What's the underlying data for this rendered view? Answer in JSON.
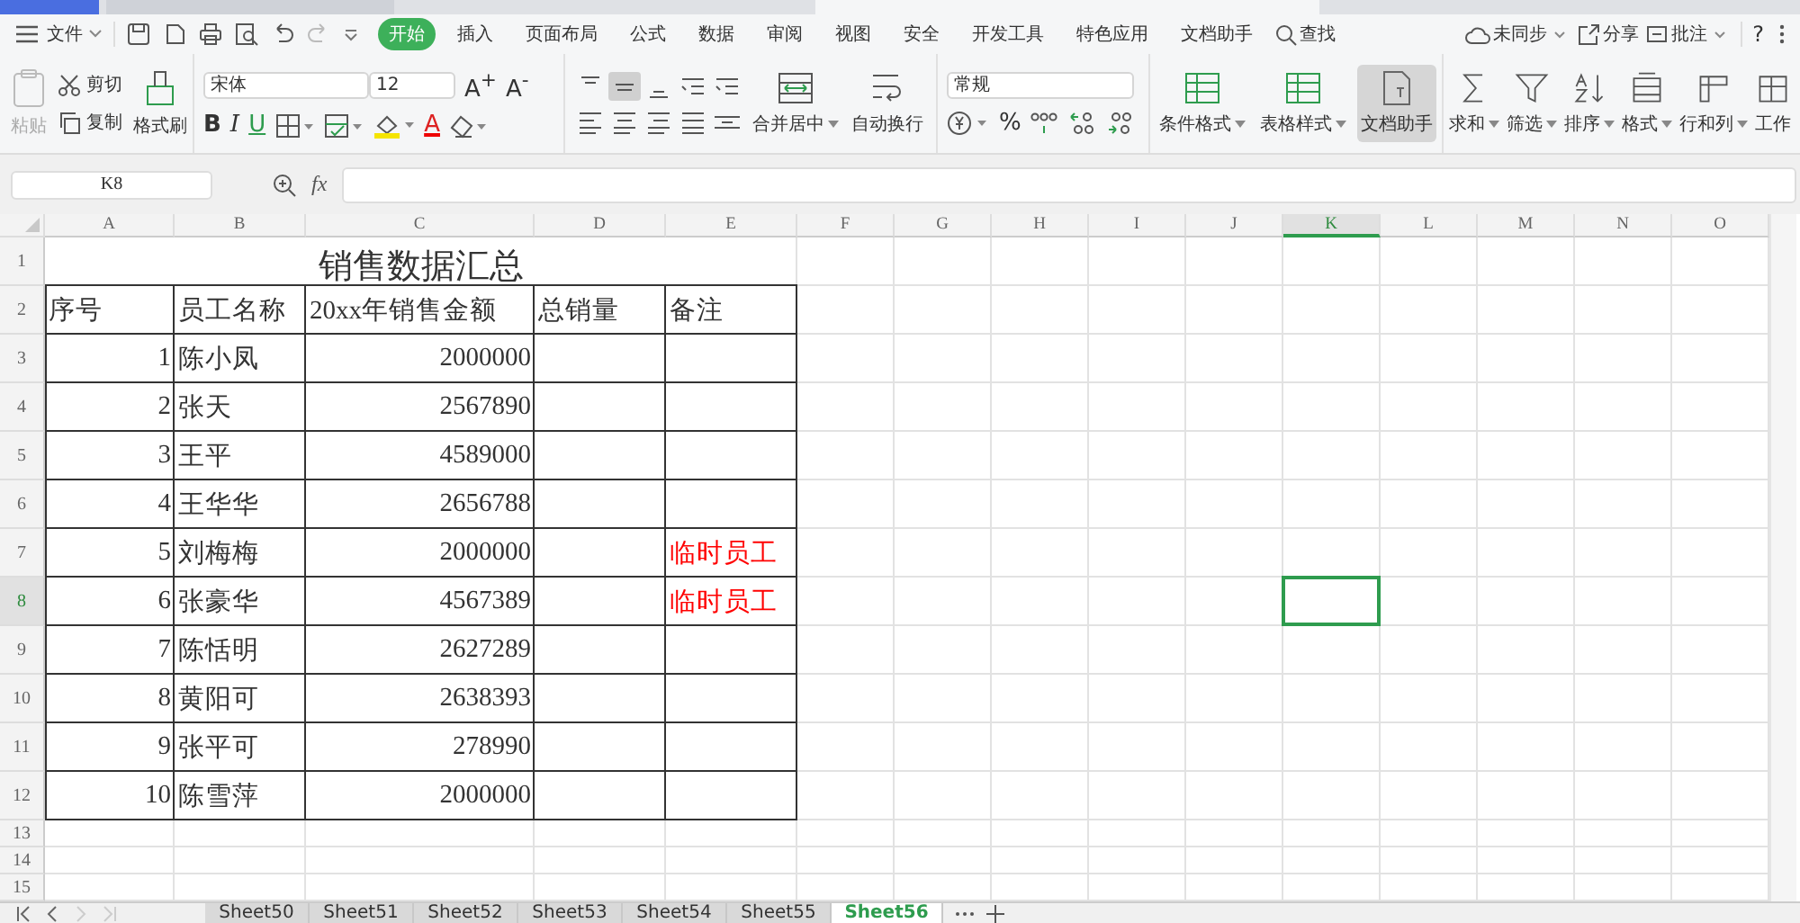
{
  "menu": {
    "file": "文件",
    "tabs": [
      {
        "label": "开始",
        "selected": true
      },
      {
        "label": "插入",
        "selected": false
      },
      {
        "label": "页面布局",
        "selected": false
      },
      {
        "label": "公式",
        "selected": false
      },
      {
        "label": "数据",
        "selected": false
      },
      {
        "label": "审阅",
        "selected": false
      },
      {
        "label": "视图",
        "selected": false
      },
      {
        "label": "安全",
        "selected": false
      },
      {
        "label": "开发工具",
        "selected": false
      },
      {
        "label": "特色应用",
        "selected": false
      },
      {
        "label": "文档助手",
        "selected": false
      }
    ],
    "search": "查找",
    "sync": "未同步",
    "share": "分享",
    "comment": "批注",
    "help": "?"
  },
  "ribbon": {
    "paste": {
      "label": "粘贴",
      "disabled": true
    },
    "cut": "剪切",
    "copy": "复制",
    "format_painter": "格式刷",
    "font_name": "宋体",
    "font_size": "12",
    "grow": "A$^{+}$",
    "shrink": "A$^{-}$",
    "bold": "B",
    "italic": "I",
    "underline": "U",
    "font_color": "A",
    "merge": "合并居中",
    "wrap": "自动换行",
    "number_format": "常规",
    "percent": "%",
    "big_buttons": [
      {
        "label": "条件格式",
        "selected": false
      },
      {
        "label": "表格样式",
        "selected": false
      },
      {
        "label": "文档助手",
        "selected": true
      }
    ],
    "tools": [
      "求和",
      "筛选",
      "排序",
      "格式",
      "行和列",
      "工作"
    ]
  },
  "formula_bar": {
    "name_box": "K8",
    "fx": "fx"
  },
  "columns": [
    {
      "label": "A",
      "selected": false
    },
    {
      "label": "B",
      "selected": false
    },
    {
      "label": "C",
      "selected": false
    },
    {
      "label": "D",
      "selected": false
    },
    {
      "label": "E",
      "selected": false
    },
    {
      "label": "F",
      "selected": false
    },
    {
      "label": "G",
      "selected": false
    },
    {
      "label": "H",
      "selected": false
    },
    {
      "label": "I",
      "selected": false
    },
    {
      "label": "J",
      "selected": false
    },
    {
      "label": "K",
      "selected": true
    },
    {
      "label": "L",
      "selected": false
    },
    {
      "label": "M",
      "selected": false
    },
    {
      "label": "N",
      "selected": false
    },
    {
      "label": "O",
      "selected": false
    }
  ],
  "row_numbers": [
    {
      "label": "1",
      "selected": false
    },
    {
      "label": "2",
      "selected": false
    },
    {
      "label": "3",
      "selected": false
    },
    {
      "label": "4",
      "selected": false
    },
    {
      "label": "5",
      "selected": false
    },
    {
      "label": "6",
      "selected": false
    },
    {
      "label": "7",
      "selected": false
    },
    {
      "label": "8",
      "selected": true
    },
    {
      "label": "9",
      "selected": false
    },
    {
      "label": "10",
      "selected": false
    },
    {
      "label": "11",
      "selected": false
    },
    {
      "label": "12",
      "selected": false
    },
    {
      "label": "13",
      "selected": false
    },
    {
      "label": "14",
      "selected": false
    },
    {
      "label": "15",
      "selected": false
    }
  ],
  "sheet_title": "销售数据汇总",
  "headers": [
    "序号",
    "员工名称",
    "20xx年销售金额",
    "总销量",
    "备注"
  ],
  "rows": [
    {
      "no": "1",
      "name": "陈小凤",
      "amount": "2000000"
    },
    {
      "no": "2",
      "name": "张天",
      "amount": "2567890"
    },
    {
      "no": "3",
      "name": "王平",
      "amount": "4589000"
    },
    {
      "no": "4",
      "name": "王华华",
      "amount": "2656788"
    },
    {
      "no": "5",
      "name": "刘梅梅",
      "amount": "2000000",
      "note": {
        "text": "临时员工",
        "color": "#ff0000"
      }
    },
    {
      "no": "6",
      "name": "张豪华",
      "amount": "4567389",
      "note": {
        "text": "临时员工",
        "color": "#ff0000"
      }
    },
    {
      "no": "7",
      "name": "陈恬明",
      "amount": "2627289"
    },
    {
      "no": "8",
      "name": "黄阳可",
      "amount": "2638393"
    },
    {
      "no": "9",
      "name": "张平可",
      "amount": "278990"
    },
    {
      "no": "10",
      "name": "陈雪萍",
      "amount": "2000000"
    }
  ],
  "sheet_tabs": [
    {
      "label": "Sheet50",
      "selected": false
    },
    {
      "label": "Sheet51",
      "selected": false
    },
    {
      "label": "Sheet52",
      "selected": false
    },
    {
      "label": "Sheet53",
      "selected": false
    },
    {
      "label": "Sheet54",
      "selected": false
    },
    {
      "label": "Sheet55",
      "selected": false
    },
    {
      "label": "Sheet56",
      "selected": true
    }
  ]
}
